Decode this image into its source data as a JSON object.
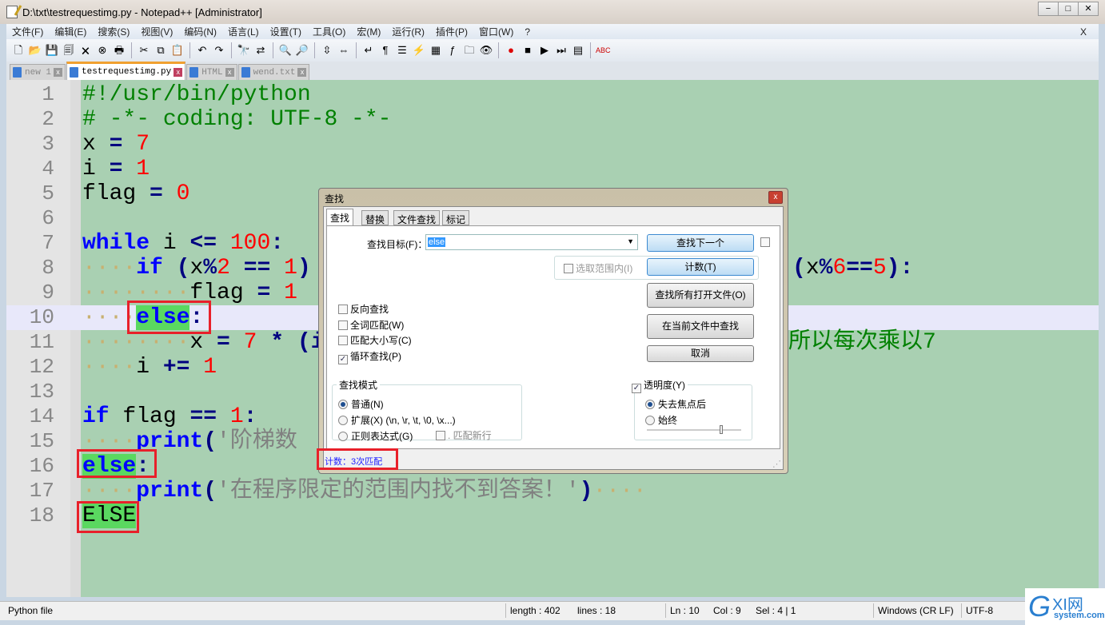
{
  "window": {
    "title": "D:\\txt\\testrequestimg.py - Notepad++ [Administrator]",
    "buttons": [
      "−",
      "□",
      "✕"
    ]
  },
  "menu": [
    "文件(F)",
    "编辑(E)",
    "搜索(S)",
    "视图(V)",
    "编码(N)",
    "语言(L)",
    "设置(T)",
    "工具(O)",
    "宏(M)",
    "运行(R)",
    "插件(P)",
    "窗口(W)",
    "?"
  ],
  "menu_close": "X",
  "toolbar": [
    "new-file",
    "open",
    "save",
    "save-all",
    "close",
    "close-all",
    "print",
    "|",
    "cut",
    "copy",
    "paste",
    "|",
    "undo",
    "redo",
    "|",
    "find",
    "replace",
    "|",
    "zoom-in",
    "zoom-out",
    "|",
    "sync-v",
    "sync-h",
    "|",
    "word-wrap",
    "show-all",
    "indent-guide",
    "udl",
    "doc-map",
    "function-list",
    "folder",
    "monitor",
    "|",
    "record",
    "stop",
    "play",
    "play-multi",
    "save-macro",
    "|",
    "spellcheck"
  ],
  "tabs": [
    {
      "label": "new 1",
      "active": false
    },
    {
      "label": "testrequestimg.py",
      "active": true
    },
    {
      "label": "HTML",
      "active": false
    },
    {
      "label": "wend.txt",
      "active": false
    }
  ],
  "code": [
    {
      "n": "1",
      "t": [
        [
          "c",
          "#!/usr/bin/python"
        ]
      ]
    },
    {
      "n": "2",
      "t": [
        [
          "c",
          "# -*- coding: UTF-8 -*-"
        ]
      ]
    },
    {
      "n": "3",
      "t": [
        [
          "t",
          "x "
        ],
        [
          "o",
          "="
        ],
        [
          "t",
          " "
        ],
        [
          "n",
          "7"
        ]
      ]
    },
    {
      "n": "4",
      "t": [
        [
          "t",
          "i "
        ],
        [
          "o",
          "="
        ],
        [
          "t",
          " "
        ],
        [
          "n",
          "1"
        ]
      ]
    },
    {
      "n": "5",
      "t": [
        [
          "t",
          "flag "
        ],
        [
          "o",
          "="
        ],
        [
          "t",
          " "
        ],
        [
          "n",
          "0"
        ]
      ]
    },
    {
      "n": "6",
      "t": []
    },
    {
      "n": "7",
      "t": [
        [
          "k",
          "while"
        ],
        [
          "t",
          " i "
        ],
        [
          "o",
          "<="
        ],
        [
          "t",
          " "
        ],
        [
          "n",
          "100"
        ],
        [
          "o",
          ":"
        ]
      ]
    },
    {
      "n": "8",
      "t": [
        [
          "d",
          "····"
        ],
        [
          "k",
          "if"
        ],
        [
          "t",
          " "
        ],
        [
          "o",
          "("
        ],
        [
          "t",
          "x"
        ],
        [
          "o",
          "%"
        ],
        [
          "n",
          "2"
        ],
        [
          "t",
          " "
        ],
        [
          "o",
          "=="
        ],
        [
          "t",
          " "
        ],
        [
          "n",
          "1"
        ],
        [
          "o",
          ")"
        ]
      ]
    },
    {
      "n": "9",
      "t": [
        [
          "d",
          "········"
        ],
        [
          "t",
          "flag "
        ],
        [
          "o",
          "="
        ],
        [
          "t",
          " "
        ],
        [
          "n",
          "1"
        ]
      ]
    },
    {
      "n": "10",
      "t": [
        [
          "d",
          "····"
        ],
        [
          "k",
          "else"
        ],
        [
          "o",
          ":"
        ]
      ]
    },
    {
      "n": "11",
      "t": [
        [
          "d",
          "········"
        ],
        [
          "t",
          "x "
        ],
        [
          "o",
          "="
        ],
        [
          "t",
          " "
        ],
        [
          "n",
          "7"
        ],
        [
          "t",
          " "
        ],
        [
          "o",
          "*"
        ],
        [
          "t",
          " "
        ],
        [
          "o",
          "(i"
        ]
      ]
    },
    {
      "n": "12",
      "t": [
        [
          "d",
          "····"
        ],
        [
          "t",
          "i "
        ],
        [
          "o",
          "+="
        ],
        [
          "t",
          " "
        ],
        [
          "n",
          "1"
        ]
      ]
    },
    {
      "n": "13",
      "t": []
    },
    {
      "n": "14",
      "t": [
        [
          "k",
          "if"
        ],
        [
          "t",
          " flag "
        ],
        [
          "o",
          "=="
        ],
        [
          "t",
          " "
        ],
        [
          "n",
          "1"
        ],
        [
          "o",
          ":"
        ]
      ]
    },
    {
      "n": "15",
      "t": [
        [
          "d",
          "····"
        ],
        [
          "k",
          "print"
        ],
        [
          "o",
          "("
        ],
        [
          "s",
          "'阶梯数"
        ]
      ]
    },
    {
      "n": "16",
      "t": [
        [
          "k",
          "else"
        ],
        [
          "o",
          ":"
        ]
      ]
    },
    {
      "n": "17",
      "t": [
        [
          "d",
          "····"
        ],
        [
          "k",
          "print"
        ],
        [
          "o",
          "("
        ],
        [
          "s",
          "'在程序限定的范围内找不到答案！'"
        ],
        [
          "o",
          ")"
        ],
        [
          "d",
          "····"
        ]
      ]
    },
    {
      "n": "18",
      "t": [
        [
          "t",
          "ElSE"
        ]
      ]
    }
  ],
  "code_right": {
    "line8": [
      [
        "o",
        "("
      ],
      [
        "t",
        "x"
      ],
      [
        "o",
        "%"
      ],
      [
        "n",
        "6"
      ],
      [
        "o",
        "=="
      ],
      [
        "n",
        "5"
      ],
      [
        "o",
        "):"
      ]
    ],
    "line11": [
      [
        "c",
        "所以每次乘以7"
      ]
    ]
  },
  "find_dialog": {
    "title": "查找",
    "tabs": [
      "查找",
      "替换",
      "文件查找",
      "标记"
    ],
    "target_label": "查找目标(F)：",
    "target_value": "else",
    "in_selection": "选取范围内(I)",
    "buttons": {
      "find_next": "查找下一个",
      "count": "计数(T)",
      "find_all_open": "查找所有打开文件(O)",
      "find_all_current": "在当前文件中查找",
      "cancel": "取消"
    },
    "options": [
      {
        "label": "反向查找",
        "checked": false
      },
      {
        "label": "全词匹配(W)",
        "checked": false
      },
      {
        "label": "匹配大小写(C)",
        "checked": false
      },
      {
        "label": "循环查找(P)",
        "checked": true
      }
    ],
    "mode_title": "查找模式",
    "modes": [
      {
        "label": "普通(N)",
        "selected": true
      },
      {
        "label": "扩展(X) (\\n, \\r, \\t, \\0, \\x...)",
        "selected": false
      },
      {
        "label": "正则表达式(G)",
        "selected": false
      }
    ],
    "dot_newline": ". 匹配新行",
    "transparency": "透明度(Y)",
    "transparency_checked": true,
    "trans_modes": [
      {
        "label": "失去焦点后",
        "selected": true
      },
      {
        "label": "始终",
        "selected": false
      }
    ],
    "transparency_level": 0.8,
    "status": "计数：3次匹配"
  },
  "status": {
    "type": "Python file",
    "length": "length : 402",
    "lines": "lines : 18",
    "ln": "Ln : 10",
    "col": "Col : 9",
    "sel": "Sel : 4 | 1",
    "eol": "Windows (CR LF)",
    "enc": "UTF-8"
  },
  "watermark": "GXI网 system.com",
  "colors": {
    "editor_bg": "#a9d0b2",
    "highlight": "#5ad860",
    "annotation": "#e8202a",
    "keyword": "#0000ff",
    "number": "#ff0000",
    "comment": "#008000"
  }
}
